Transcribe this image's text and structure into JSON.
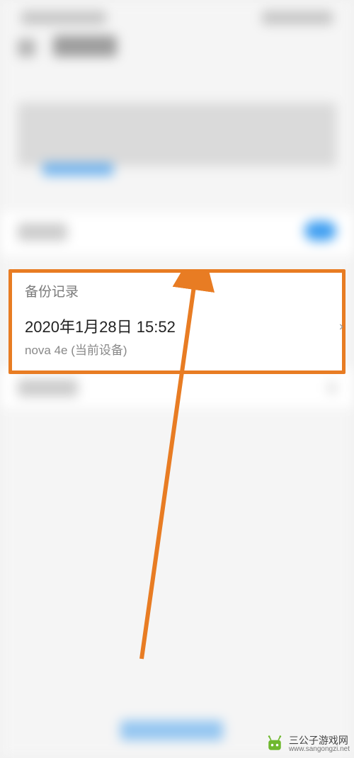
{
  "backup_section": {
    "title": "备份记录",
    "date": "2020年1月28日 15:52",
    "device": "nova 4e (当前设备)"
  },
  "highlight": {
    "border_color": "#e87c23",
    "arrow_color": "#e87c23"
  },
  "watermark": {
    "site_name": "三公子游戏网",
    "site_url": "www.sangongzi.net",
    "icon_color": "#6fb82e"
  }
}
